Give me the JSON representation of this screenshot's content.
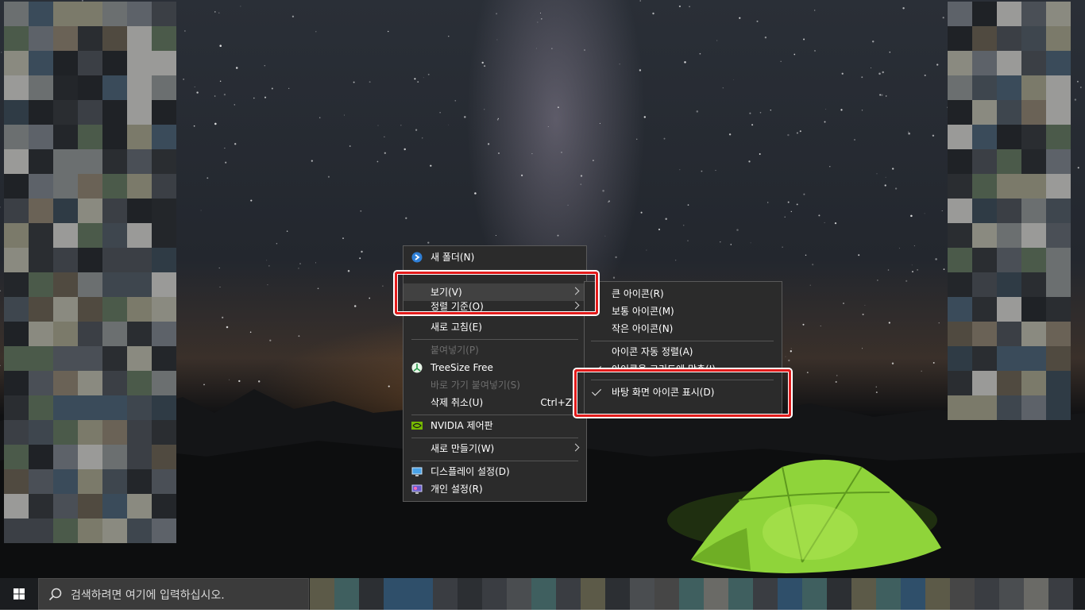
{
  "context_menu": {
    "items": [
      {
        "label": "새 폴더(N)",
        "icon": "new-folder-icon",
        "disabled": false
      },
      {
        "label": "보기(V)",
        "submenu": true,
        "hover": true
      },
      {
        "label": "정렬 기준(O)",
        "submenu": true,
        "partially_hidden": true
      },
      {
        "label": "새로 고침(E)"
      },
      {
        "label": "붙여넣기(P)",
        "disabled": true
      },
      {
        "label": "TreeSize Free",
        "icon": "treesize-icon"
      },
      {
        "label": "바로 가기 붙여넣기(S)",
        "disabled": true
      },
      {
        "label": "삭제 취소(U)",
        "shortcut": "Ctrl+Z"
      },
      {
        "label": "NVIDIA 제어판",
        "icon": "nvidia-icon"
      },
      {
        "label": "새로 만들기(W)",
        "submenu": true
      },
      {
        "label": "디스플레이 설정(D)",
        "icon": "display-icon"
      },
      {
        "label": "개인 설정(R)",
        "icon": "personalize-icon"
      }
    ]
  },
  "view_submenu": {
    "items": [
      {
        "label": "큰 아이콘(R)"
      },
      {
        "label": "보통 아이콘(M)"
      },
      {
        "label": "작은 아이콘(N)"
      },
      {
        "label": "아이콘 자동 정렬(A)"
      },
      {
        "label": "아이콘을 그리드에 맞춤(I)",
        "checked": true,
        "partially_hidden": true
      },
      {
        "label": "바탕 화면 아이콘 표시(D)",
        "checked": true
      }
    ]
  },
  "taskbar": {
    "search_placeholder": "검색하려면 여기에 입력하십시오.",
    "start_icon": "windows-logo-icon",
    "search_icon": "search-icon"
  },
  "colors": {
    "menu_bg": "#2b2b2b",
    "highlight_border": "#e21b1b",
    "tent": "#8fd43a",
    "taskbar": "#1b1d20"
  }
}
